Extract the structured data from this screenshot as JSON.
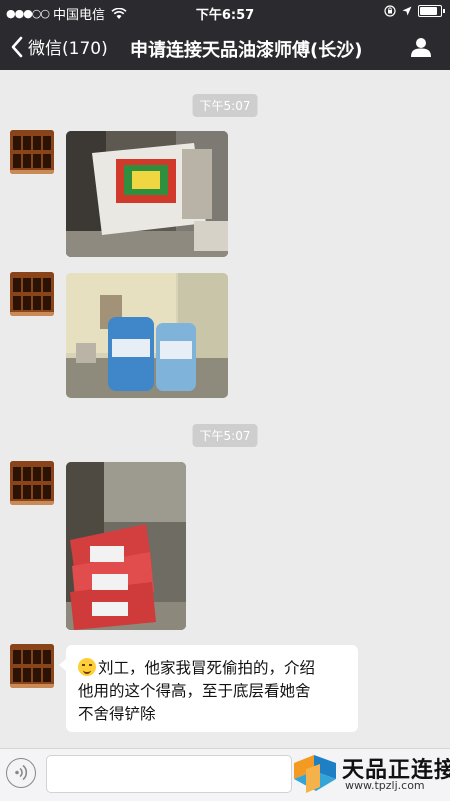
{
  "status_bar": {
    "signal": "●●●○○",
    "carrier": "中国电信",
    "time": "下午6:57"
  },
  "nav": {
    "back_label": "微信(170)",
    "title": "申请连接天品油漆师傅(长沙)"
  },
  "messages": {
    "timestamp_1": "下午5:07",
    "timestamp_2": "下午5:07",
    "photo_1": "photo-message",
    "photo_2": "photo-message",
    "photo_3": "photo-message",
    "text_line_1": "刘工，他家我冒死偷拍的，介绍",
    "text_line_2": "他用的这个得高，至于底层看她舍",
    "text_line_3": "不舍得铲除"
  },
  "input": {
    "placeholder": ""
  },
  "watermark": {
    "title": "天品正连接",
    "url": "www.tpzlj.com"
  },
  "colors": {
    "header_bg": "#2b2b2f",
    "chat_bg": "#ebebeb",
    "timestamp_bg": "#cecece",
    "bubble_bg": "#ffffff"
  }
}
